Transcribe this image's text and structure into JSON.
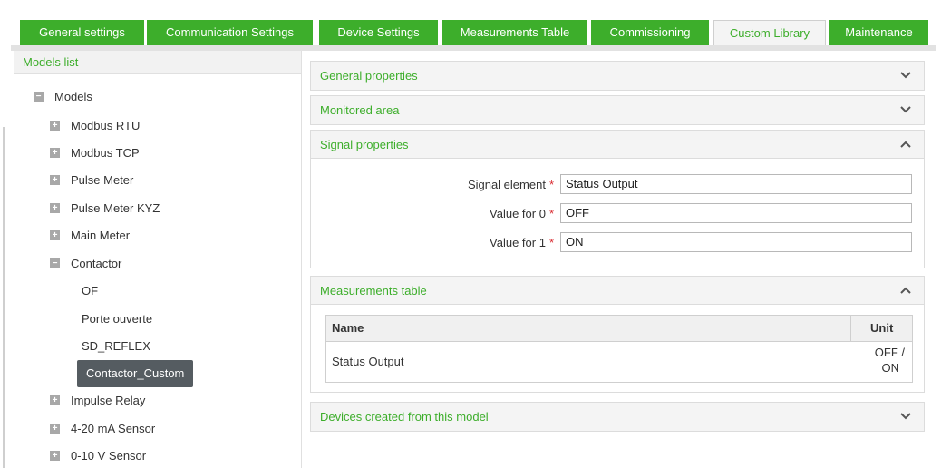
{
  "tabs": [
    {
      "label": "General settings",
      "active": false
    },
    {
      "label": "Communication Settings",
      "active": false
    },
    {
      "label": "Device Settings",
      "active": false
    },
    {
      "label": "Measurements Table",
      "active": false
    },
    {
      "label": "Commissioning",
      "active": false
    },
    {
      "label": "Custom Library",
      "active": true
    },
    {
      "label": "Maintenance",
      "active": false
    }
  ],
  "sidebar": {
    "title": "Models list",
    "root": "Models",
    "items": [
      {
        "label": "Modbus RTU",
        "expander": "+"
      },
      {
        "label": "Modbus TCP",
        "expander": "+"
      },
      {
        "label": "Pulse Meter",
        "expander": "+"
      },
      {
        "label": "Pulse Meter KYZ",
        "expander": "+"
      },
      {
        "label": "Main Meter",
        "expander": "+"
      },
      {
        "label": "Contactor",
        "expander": "−"
      },
      {
        "label": "OF"
      },
      {
        "label": "Porte ouverte"
      },
      {
        "label": "SD_REFLEX"
      },
      {
        "label": "Contactor_Custom",
        "selected": true
      },
      {
        "label": "Impulse Relay",
        "expander": "+"
      },
      {
        "label": "4-20 mA Sensor",
        "expander": "+"
      },
      {
        "label": "0-10 V Sensor",
        "expander": "+"
      }
    ]
  },
  "panels": {
    "general": {
      "title": "General properties",
      "state": "collapsed"
    },
    "monitored": {
      "title": "Monitored area",
      "state": "collapsed"
    },
    "signal": {
      "title": "Signal properties",
      "state": "expanded",
      "fields": [
        {
          "label": "Signal element",
          "required": "*",
          "value": "Status Output"
        },
        {
          "label": "Value for 0",
          "required": "*",
          "value": "OFF"
        },
        {
          "label": "Value for 1",
          "required": "*",
          "value": "ON"
        }
      ]
    },
    "measurements": {
      "title": "Measurements table",
      "state": "expanded",
      "columns": {
        "name": "Name",
        "unit": "Unit"
      },
      "rows": [
        {
          "name": "Status Output",
          "unit_line1": "OFF /",
          "unit_line2": "ON"
        }
      ]
    },
    "devices": {
      "title": "Devices created from this model",
      "state": "collapsed"
    }
  },
  "icons": {
    "expand": "plus-box-icon",
    "collapse": "minus-box-icon",
    "panel_collapsed": "chevron-down-icon",
    "panel_expanded": "chevron-up-icon"
  },
  "colors": {
    "accent": "#3dae2b",
    "selected_bg": "#555c61",
    "required": "#d9292f"
  }
}
